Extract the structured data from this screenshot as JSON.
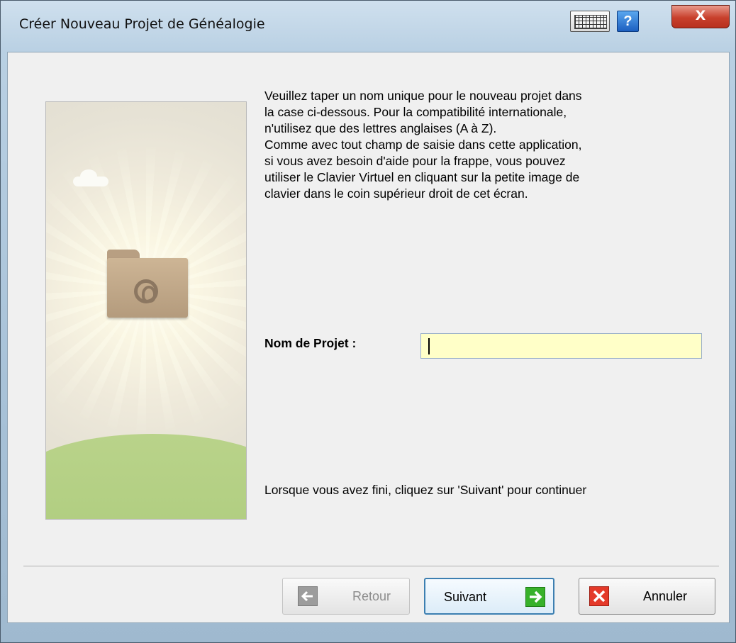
{
  "window": {
    "title": "Créer Nouveau Projet de Généalogie",
    "help_label": "?",
    "close_label": "X"
  },
  "content": {
    "instructions": "Veuillez taper un nom unique pour le nouveau projet dans\nla case ci-dessous. Pour la compatibilité internationale,\nn'utilisez que des lettres anglaises (A à Z).\nComme avec tout champ de saisie dans cette application,\nsi vous avez besoin d'aide pour la frappe, vous pouvez\nutiliser le Clavier Virtuel en cliquant sur la petite image de\nclavier dans le coin supérieur droit de cet écran.",
    "project_name_label": "Nom de Projet :",
    "project_name_value": "",
    "finish_text": "Lorsque vous avez fini, cliquez sur 'Suivant' pour continuer"
  },
  "buttons": {
    "back_label": "Retour",
    "next_label": "Suivant",
    "cancel_label": "Annuler"
  },
  "colors": {
    "input_background": "#ffffc8",
    "next_icon": "#37b12b",
    "cancel_icon": "#e43a2a",
    "back_icon_disabled": "#9c9c9c"
  },
  "icons": {
    "keyboard": "keyboard-icon",
    "help": "help-icon",
    "close": "close-icon",
    "back": "arrow-left-icon",
    "next": "arrow-right-icon",
    "cancel": "x-icon",
    "folder": "folder-icon"
  }
}
